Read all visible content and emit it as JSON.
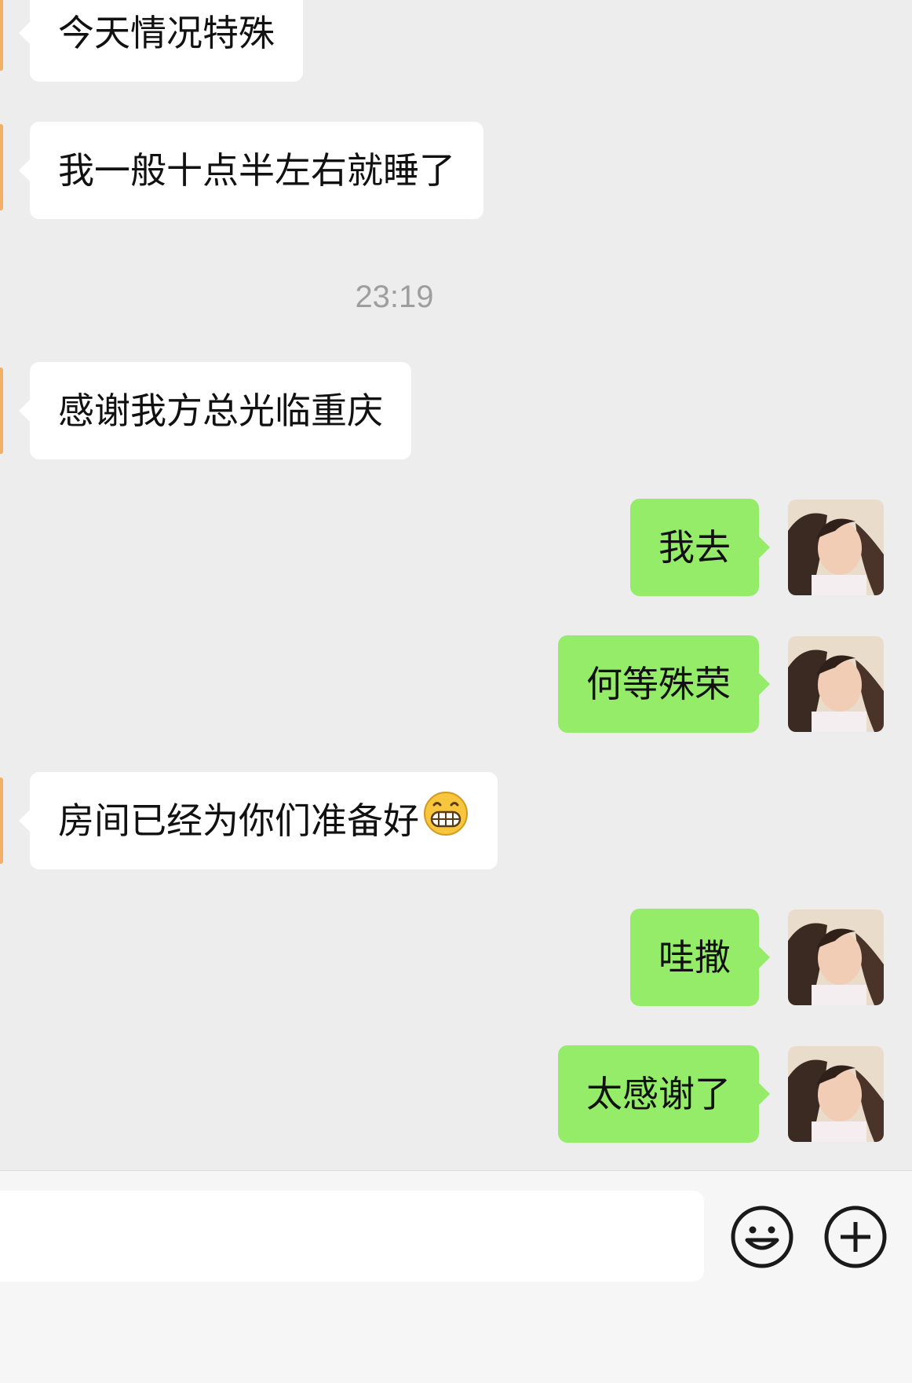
{
  "messages": [
    {
      "side": "in",
      "text": "今天情况特殊"
    },
    {
      "side": "in",
      "text": "我一般十点半左右就睡了"
    },
    {
      "side": "in",
      "text": "感谢我方总光临重庆"
    },
    {
      "side": "out",
      "text": "我去"
    },
    {
      "side": "out",
      "text": "何等殊荣"
    },
    {
      "side": "in",
      "text": "房间已经为你们准备好",
      "emoji": "grinning-face-emoji"
    },
    {
      "side": "out",
      "text": "哇撒"
    },
    {
      "side": "out",
      "text": "太感谢了"
    }
  ],
  "timestamp": "23:19",
  "input": {
    "value": "",
    "placeholder": ""
  },
  "colors": {
    "background": "#ededed",
    "incoming_bubble": "#ffffff",
    "outgoing_bubble": "#95ec69",
    "timestamp_text": "#9e9e9e"
  },
  "icons": {
    "emoji_button": "smiley-face-icon",
    "more_button": "plus-circle-icon"
  }
}
